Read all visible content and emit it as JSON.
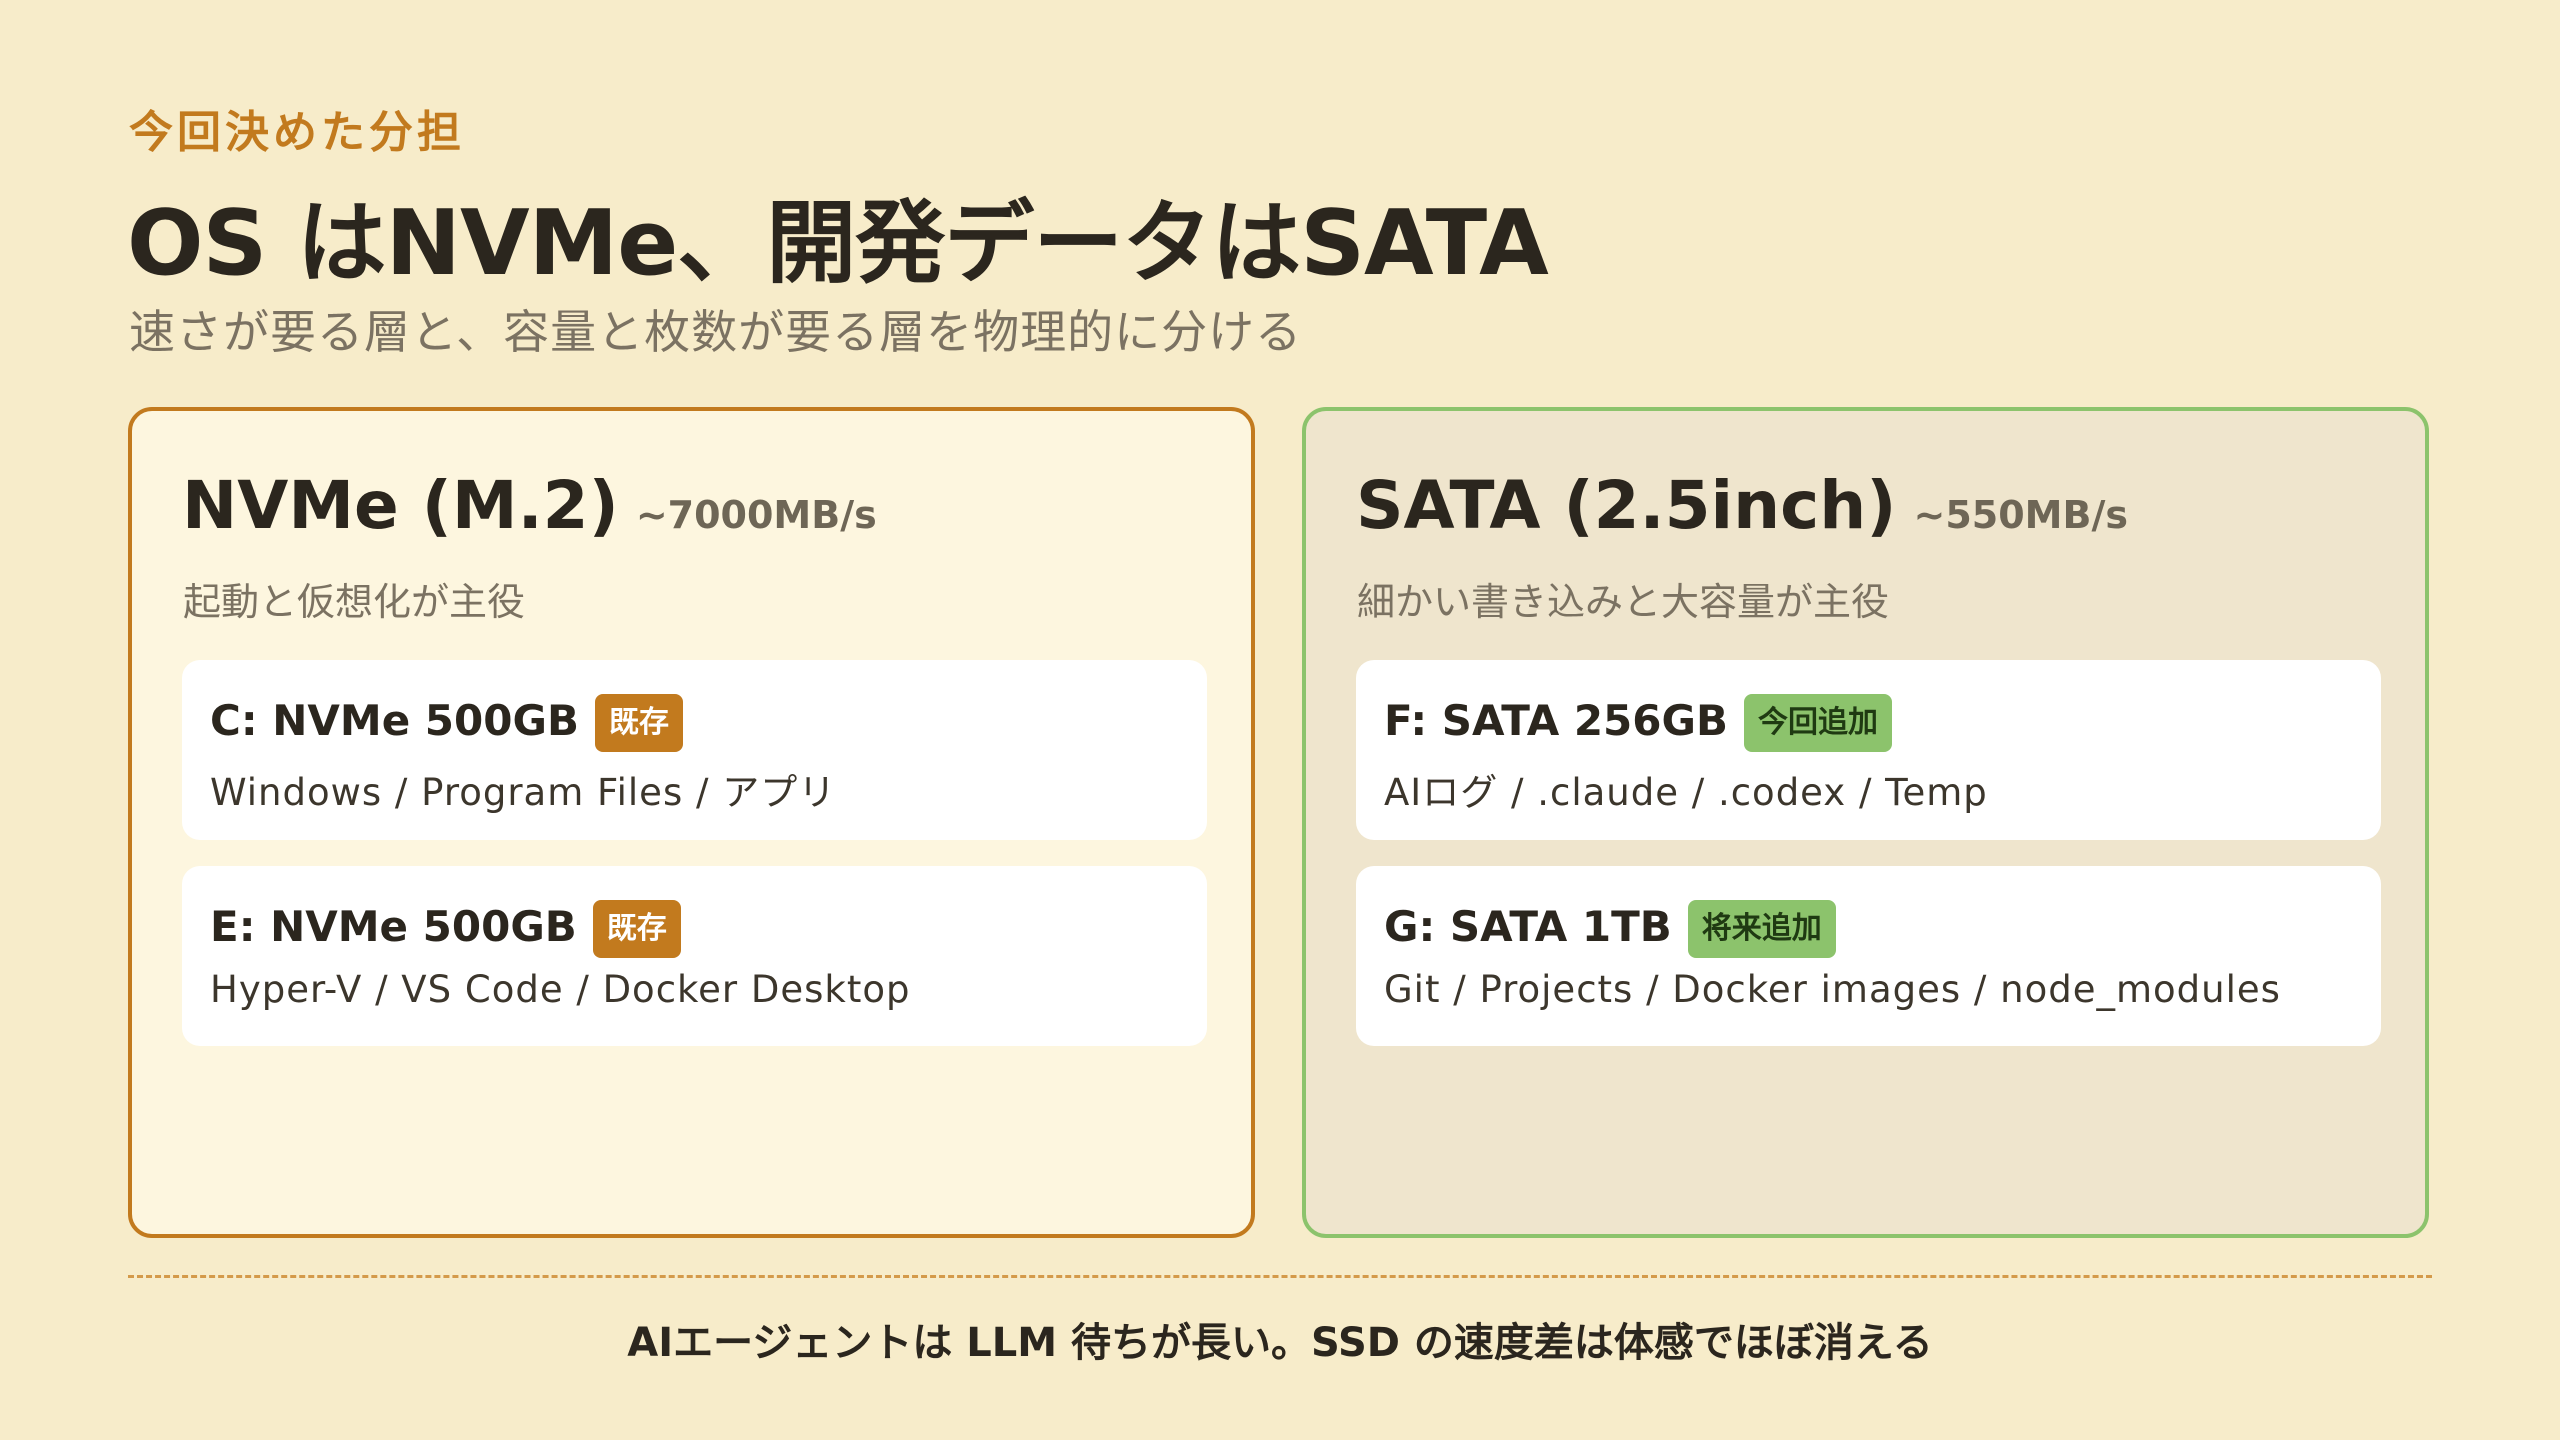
{
  "header": {
    "eyebrow": "今回決めた分担",
    "title": "OS はNVMe、開発データはSATA",
    "subtitle": "速さが要る層と、容量と枚数が要る層を物理的に分ける"
  },
  "panels": {
    "nvme": {
      "name": "NVMe (M.2)",
      "speed": "~7000MB/s",
      "description": "起動と仮想化が主役",
      "drives": [
        {
          "title": "C: NVMe 500GB",
          "badge": "既存",
          "contents": "Windows / Program Files / アプリ"
        },
        {
          "title": "E: NVMe 500GB",
          "badge": "既存",
          "contents": "Hyper-V / VS Code / Docker Desktop"
        }
      ]
    },
    "sata": {
      "name": "SATA (2.5inch)",
      "speed": "~550MB/s",
      "description": "細かい書き込みと大容量が主役",
      "drives": [
        {
          "title": "F: SATA 256GB",
          "badge": "今回追加",
          "contents": "AIログ / .claude / .codex / Temp"
        },
        {
          "title": "G: SATA 1TB",
          "badge": "将来追加",
          "contents": "Git / Projects / Docker images / node_modules"
        }
      ]
    }
  },
  "footer": {
    "text": "AIエージェントは LLM 待ちが長い。SSD の速度差は体感でほぼ消える"
  },
  "colors": {
    "background": "#f7ecca",
    "accent_orange": "#c27a1e",
    "accent_green": "#8cc36c",
    "nvme_panel_bg": "#fdf6df",
    "sata_panel_bg": "#efe5cd"
  }
}
